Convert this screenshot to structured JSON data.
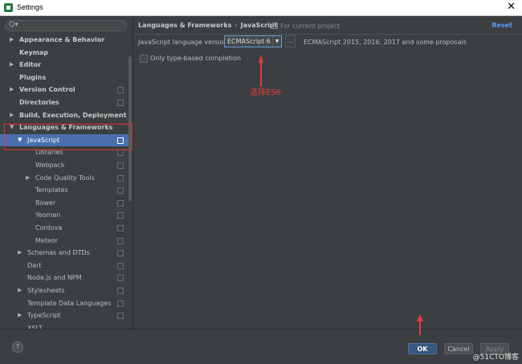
{
  "window": {
    "title": "Settings",
    "close_icon": "close-icon"
  },
  "sidebar": {
    "search_placeholder": "Q▾",
    "items": [
      {
        "label": "Appearance & Behavior",
        "indent": 0,
        "arrow": "▶",
        "bold": true,
        "copy": false
      },
      {
        "label": "Keymap",
        "indent": 0,
        "arrow": "",
        "bold": true,
        "copy": false
      },
      {
        "label": "Editor",
        "indent": 0,
        "arrow": "▶",
        "bold": true,
        "copy": false
      },
      {
        "label": "Plugins",
        "indent": 0,
        "arrow": "",
        "bold": true,
        "copy": false
      },
      {
        "label": "Version Control",
        "indent": 0,
        "arrow": "▶",
        "bold": true,
        "copy": true
      },
      {
        "label": "Directories",
        "indent": 0,
        "arrow": "",
        "bold": true,
        "copy": true
      },
      {
        "label": "Build, Execution, Deployment",
        "indent": 0,
        "arrow": "▶",
        "bold": true,
        "copy": false
      },
      {
        "label": "Languages & Frameworks",
        "indent": 0,
        "arrow": "▼",
        "bold": true,
        "copy": false
      },
      {
        "label": "JavaScript",
        "indent": 1,
        "arrow": "▼",
        "bold": false,
        "copy": true,
        "selected": true
      },
      {
        "label": "Libraries",
        "indent": 2,
        "arrow": "",
        "bold": false,
        "copy": true
      },
      {
        "label": "Webpack",
        "indent": 2,
        "arrow": "",
        "bold": false,
        "copy": true
      },
      {
        "label": "Code Quality Tools",
        "indent": 2,
        "arrow": "▶",
        "bold": false,
        "copy": true
      },
      {
        "label": "Templates",
        "indent": 2,
        "arrow": "",
        "bold": false,
        "copy": true
      },
      {
        "label": "Bower",
        "indent": 2,
        "arrow": "",
        "bold": false,
        "copy": true
      },
      {
        "label": "Yeoman",
        "indent": 2,
        "arrow": "",
        "bold": false,
        "copy": true
      },
      {
        "label": "Cordova",
        "indent": 2,
        "arrow": "",
        "bold": false,
        "copy": true
      },
      {
        "label": "Meteor",
        "indent": 2,
        "arrow": "",
        "bold": false,
        "copy": true
      },
      {
        "label": "Schemas and DTDs",
        "indent": 1,
        "arrow": "▶",
        "bold": false,
        "copy": true
      },
      {
        "label": "Dart",
        "indent": 1,
        "arrow": "",
        "bold": false,
        "copy": true
      },
      {
        "label": "Node.js and NPM",
        "indent": 1,
        "arrow": "",
        "bold": false,
        "copy": true
      },
      {
        "label": "Stylesheets",
        "indent": 1,
        "arrow": "▶",
        "bold": false,
        "copy": true
      },
      {
        "label": "Template Data Languages",
        "indent": 1,
        "arrow": "",
        "bold": false,
        "copy": true
      },
      {
        "label": "TypeScript",
        "indent": 1,
        "arrow": "▶",
        "bold": false,
        "copy": true
      },
      {
        "label": "XSLT",
        "indent": 1,
        "arrow": "",
        "bold": false,
        "copy": false
      }
    ]
  },
  "content": {
    "breadcrumb": {
      "parent": "Languages & Frameworks",
      "separator": "›",
      "current": "JavaScript"
    },
    "scope": "For current project",
    "reset": "Reset",
    "language_version_label": "JavaScript language version",
    "language_version_value": "ECMAScript 6",
    "dropdown_arrow": "▼",
    "more_button": "...",
    "language_version_desc": "ECMAScript 2015, 2016, 2017 and some proposals",
    "only_type_based_label": "Only type-based completion",
    "only_type_based_checked": false,
    "annotation": "选择ES6"
  },
  "footer": {
    "help": "?",
    "ok": "OK",
    "cancel": "Cancel",
    "apply": "Apply",
    "watermark": "@51CTO博客"
  },
  "colors": {
    "selection": "#4b6eaf",
    "annotation": "#e83a3a",
    "link": "#589df6",
    "ok_button": "#365880"
  }
}
